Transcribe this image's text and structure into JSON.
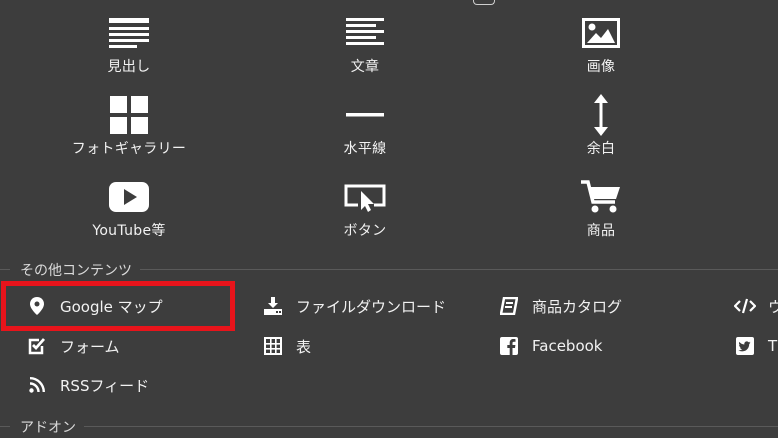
{
  "blocks": [
    {
      "label": "見出し",
      "icon": "heading-icon"
    },
    {
      "label": "文章",
      "icon": "text-icon"
    },
    {
      "label": "画像",
      "icon": "image-icon"
    },
    {
      "label": "フォトギャラリー",
      "icon": "gallery-icon"
    },
    {
      "label": "水平線",
      "icon": "horizontal-line-icon"
    },
    {
      "label": "余白",
      "icon": "spacing-icon"
    },
    {
      "label": "YouTube等",
      "icon": "video-icon"
    },
    {
      "label": "ボタン",
      "icon": "button-icon"
    },
    {
      "label": "商品",
      "icon": "cart-icon"
    }
  ],
  "sections": {
    "other": "その他コンテンツ",
    "addon": "アドオン"
  },
  "other_items": [
    {
      "label": "Google マップ",
      "icon": "map-pin-icon"
    },
    {
      "label": "ファイルダウンロード",
      "icon": "download-icon"
    },
    {
      "label": "商品カタログ",
      "icon": "catalog-icon"
    },
    {
      "label": "ウ",
      "icon": "code-icon"
    },
    {
      "label": "フォーム",
      "icon": "form-checkbox-icon"
    },
    {
      "label": "表",
      "icon": "table-icon"
    },
    {
      "label": "Facebook",
      "icon": "facebook-icon"
    },
    {
      "label": "T",
      "icon": "twitter-icon"
    },
    {
      "label": "RSSフィード",
      "icon": "rss-icon"
    }
  ],
  "highlight_color": "#e8141b"
}
